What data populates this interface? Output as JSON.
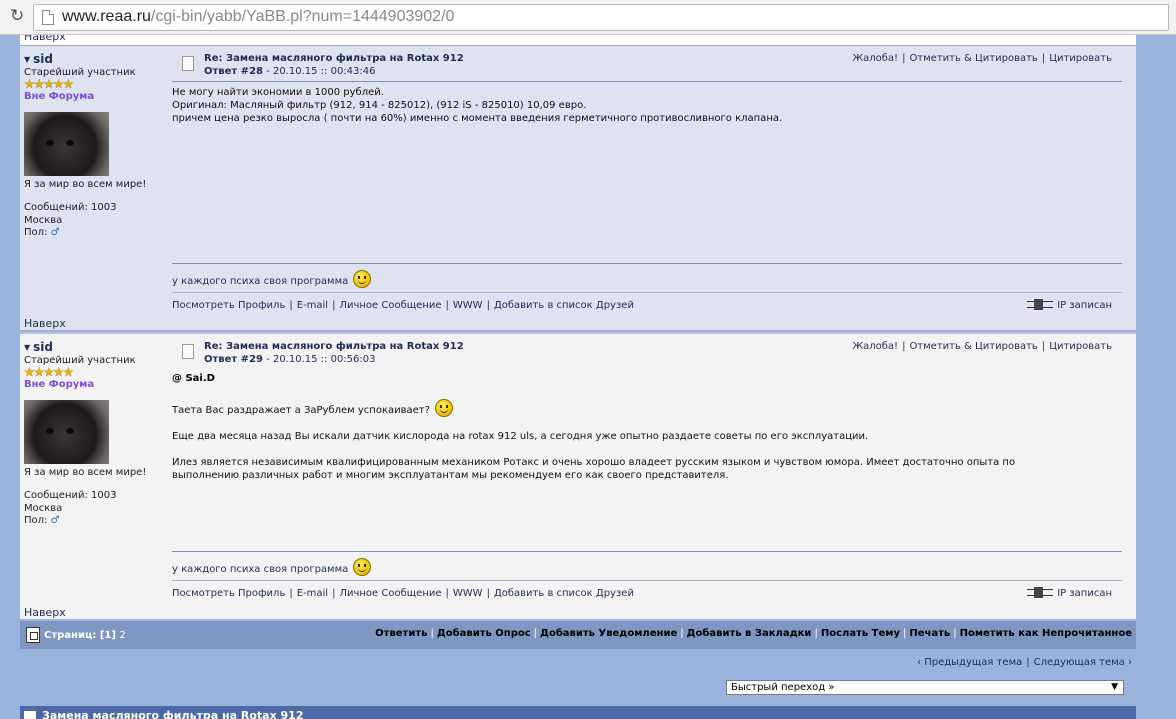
{
  "browser": {
    "url_host": "www.reaa.ru",
    "url_path": "/cgi-bin/yabb/YaBB.pl?num=1444903902/0"
  },
  "naverh": "Наверх",
  "posts": [
    {
      "author": "sid",
      "rank": "Старейший участник",
      "stars": "★★★★★",
      "status": "Вне Форума",
      "motto": "Я за мир во всем мире!",
      "messages": "Сообщений: 1003",
      "city": "Москва",
      "gender_label": "Пол:",
      "gender_icon": "♂",
      "title": "Re: Замена масляного фильтра на Rotax 912",
      "reply_no": "Ответ #28",
      "reply_date": " - 20.10.15 :: 00:43:46",
      "actions": [
        "Жалоба!",
        "Отметить & Цитировать",
        "Цитировать"
      ],
      "body": [
        "Не могу найти экономии в 1000 рублей.",
        "Оригинал: Масляный фильтр (912, 914 - 825012), (912 iS - 825010) 10,09 евро.",
        "причем цена резко выросла ( почти на 60%) именно с момента введения герметичного противосливного клапана."
      ],
      "signature": "у каждого психа своя программа",
      "links": [
        "Посмотреть Профиль",
        "E-mail",
        "Личное Сообщение",
        "WWW",
        "Добавить в список Друзей"
      ],
      "ip": "IP записан"
    },
    {
      "author": "sid",
      "rank": "Старейший участник",
      "stars": "★★★★★",
      "status": "Вне Форума",
      "motto": "Я за мир во всем мире!",
      "messages": "Сообщений: 1003",
      "city": "Москва",
      "gender_label": "Пол:",
      "gender_icon": "♂",
      "title": "Re: Замена масляного фильтра на Rotax 912",
      "reply_no": "Ответ #29",
      "reply_date": " - 20.10.15 :: 00:56:03",
      "actions": [
        "Жалоба!",
        "Отметить & Цитировать",
        "Цитировать"
      ],
      "mention": "@ Sai.D",
      "body": [
        "Таета Вас раздражает а ЗаРублем успокаивает?",
        "Еще два месяца назад Вы искали датчик кислорода на rotax 912 uls, а сегодня уже опытно раздаете советы по его эксплуатации.",
        "Илез является независимым квалифицированным механиком Ротакс и очень хорошо владеет русским языком и чувством юмора. Имеет достаточно опыта по",
        "выполнению различных работ и многим эксплуатантам мы рекомендуем его как своего представителя."
      ],
      "signature": "у каждого психа своя программа",
      "links": [
        "Посмотреть Профиль",
        "E-mail",
        "Личное Сообщение",
        "WWW",
        "Добавить в список Друзей"
      ],
      "ip": "IP записан"
    }
  ],
  "bottombar": {
    "pages_label": "Страниц:",
    "page_current": "[1]",
    "page_next": "2",
    "actions": [
      "Ответить",
      "Добавить Опрос",
      "Добавить Уведомление",
      "Добавить в Закладки",
      "Послать Тему",
      "Печать",
      "Пометить как Непрочитанное"
    ]
  },
  "nav": {
    "prev": "‹ Предыдущая тема",
    "next": "Следующая тема ›"
  },
  "jump": {
    "label": "Быстрый переход »",
    "arrow": "▼"
  },
  "footer_title": "Замена масляного фильтра на Rotax 912"
}
